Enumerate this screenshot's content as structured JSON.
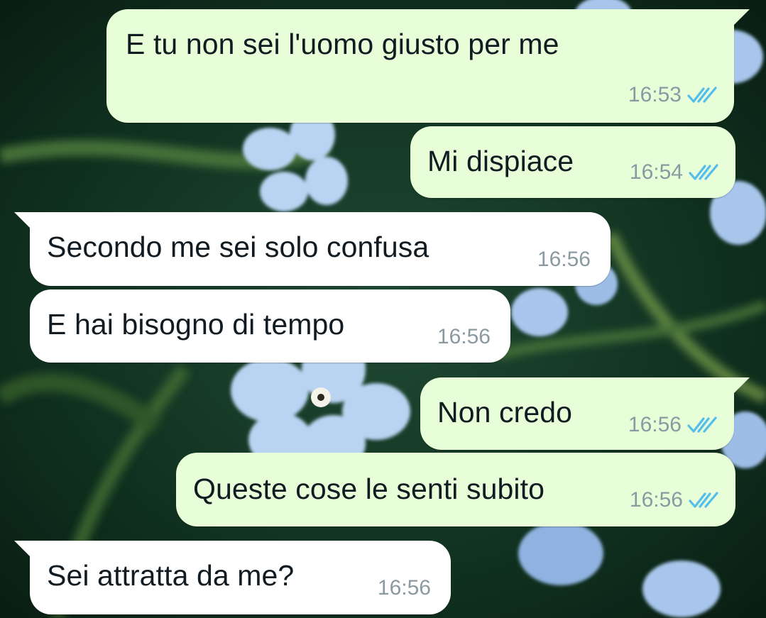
{
  "messages": [
    {
      "text": "E tu non sei l'uomo giusto per me",
      "time": "16:53",
      "direction": "outgoing",
      "status": "read",
      "status_icon": "double-check-icon"
    },
    {
      "text": "Mi dispiace",
      "time": "16:54",
      "direction": "outgoing",
      "status": "read",
      "status_icon": "double-check-icon"
    },
    {
      "text": "Secondo me sei solo confusa",
      "time": "16:56",
      "direction": "incoming"
    },
    {
      "text": "E hai bisogno di tempo",
      "time": "16:56",
      "direction": "incoming"
    },
    {
      "text": "Non credo",
      "time": "16:56",
      "direction": "outgoing",
      "status": "read",
      "status_icon": "double-check-icon"
    },
    {
      "text": "Queste cose le senti subito",
      "time": "16:56",
      "direction": "outgoing",
      "status": "read",
      "status_icon": "double-check-icon"
    },
    {
      "text": "Sei attratta da me?",
      "time": "16:56",
      "direction": "incoming"
    }
  ],
  "colors": {
    "outgoing_bubble": "#e7fed9",
    "incoming_bubble": "#ffffff",
    "read_ticks": "#53bdeb",
    "timestamp": "#8a9aa0"
  }
}
